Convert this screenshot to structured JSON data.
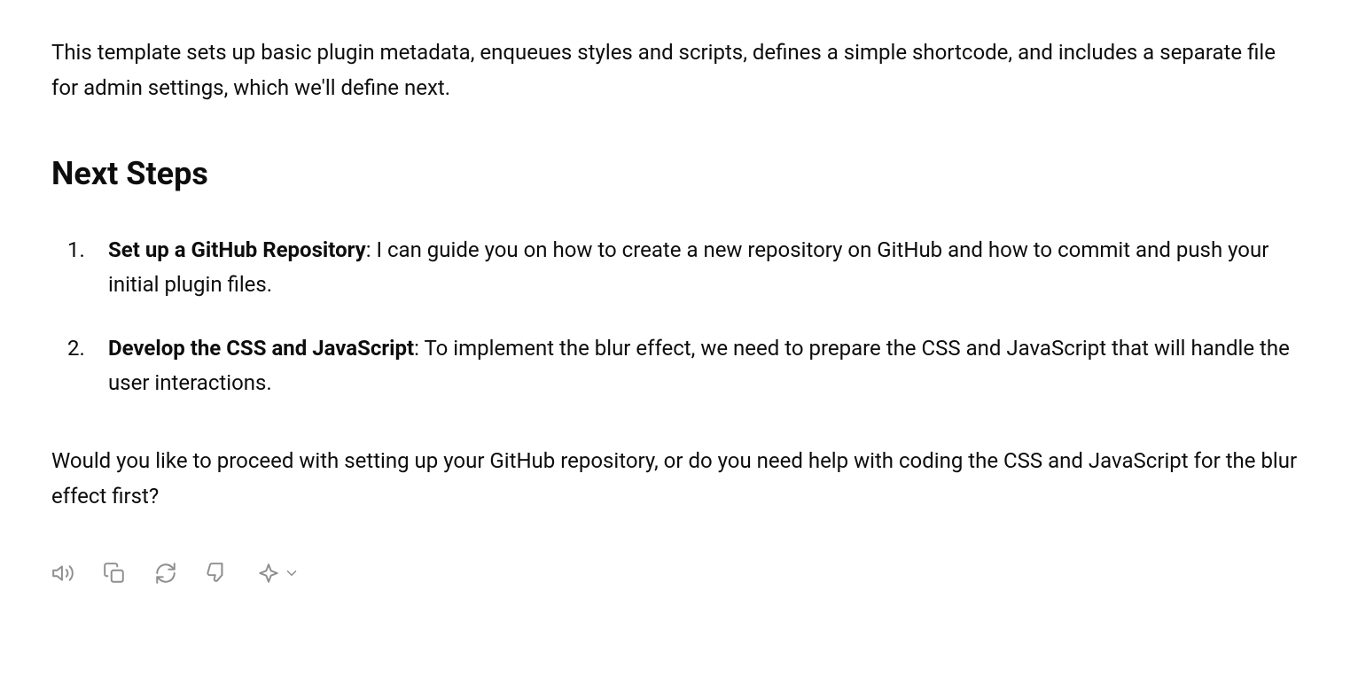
{
  "intro": "This template sets up basic plugin metadata, enqueues styles and scripts, defines a simple shortcode, and includes a separate file for admin settings, which we'll define next.",
  "heading": "Next Steps",
  "steps": [
    {
      "title": "Set up a GitHub Repository",
      "body": ": I can guide you on how to create a new repository on GitHub and how to commit and push your initial plugin files."
    },
    {
      "title": "Develop the CSS and JavaScript",
      "body": ": To implement the blur effect, we need to prepare the CSS and JavaScript that will handle the user interactions."
    }
  ],
  "closing": "Would you like to proceed with setting up your GitHub repository, or do you need help with coding the CSS and JavaScript for the blur effect first?"
}
